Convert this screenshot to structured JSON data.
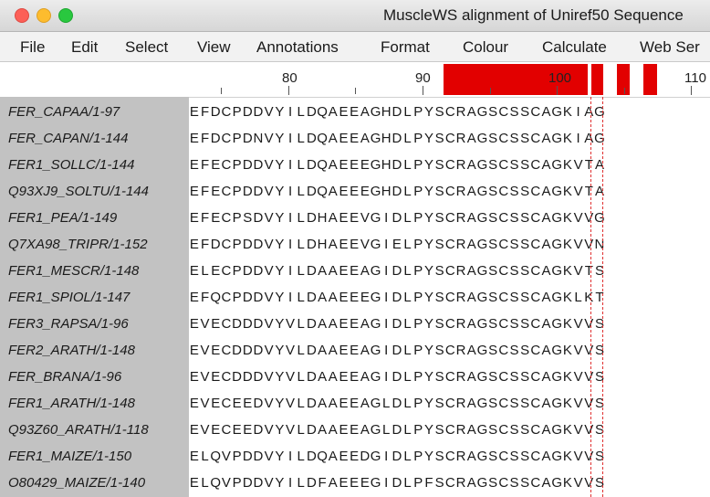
{
  "window": {
    "title": "MuscleWS alignment of Uniref50 Sequence"
  },
  "menu": [
    "File",
    "Edit",
    "Select",
    "View",
    "Annotations",
    "Format",
    "Colour",
    "Calculate",
    "Web Ser"
  ],
  "ruler": {
    "labels": [
      "80",
      "90",
      "100",
      "110"
    ]
  },
  "colors": {
    "conservation_bar": "#e20000",
    "name_panel": "#c2c2c2",
    "selection_marker": "#e03030"
  },
  "rows": [
    {
      "name": "FER_CAPAA/1-97",
      "seq": "EFDCPDDVYILDQAEEAGHDLPYSCRAGSCSSCAGKIAG"
    },
    {
      "name": "FER_CAPAN/1-144",
      "seq": "EFDCPDNVYILDQAEEAGHDLPYSCRAGSCSSCAGKIAG"
    },
    {
      "name": "FER1_SOLLC/1-144",
      "seq": "EFECPDDVYILDQAEEEGHDLPYSCRAGSCSSCAGKVTA"
    },
    {
      "name": "Q93XJ9_SOLTU/1-144",
      "seq": "EFECPDDVYILDQAEEEGHDLPYSCRAGSCSSCAGKVTA"
    },
    {
      "name": "FER1_PEA/1-149",
      "seq": "EFECPSDVYILDHAEEVGIDLPYSCRAGSCSSCAGKVVG"
    },
    {
      "name": "Q7XA98_TRIPR/1-152",
      "seq": "EFDCPDDVYILDHAEEVGIELPYSCRAGSCSSCAGKVVN"
    },
    {
      "name": "FER1_MESCR/1-148",
      "seq": "ELECPDDVYILDAAEEAGIDLPYSCRAGSCSSCAGKVTS"
    },
    {
      "name": "FER1_SPIOL/1-147",
      "seq": "EFQCPDDVYILDAAEEEGIDLPYSCRAGSCSSCAGKLKT"
    },
    {
      "name": "FER3_RAPSA/1-96",
      "seq": "EVECDDDVYVLDAAEEAGIDLPYSCRAGSCSSCAGKVVS"
    },
    {
      "name": "FER2_ARATH/1-148",
      "seq": "EVECDDDVYVLDAAEEAGIDLPYSCRAGSCSSCAGKVVS"
    },
    {
      "name": "FER_BRANA/1-96",
      "seq": "EVECDDDVYVLDAAEEAGIDLPYSCRAGSCSSCAGKVVS"
    },
    {
      "name": "FER1_ARATH/1-148",
      "seq": "EVECEEDVYVLDAAEEAGLDLPYSCRAGSCSSCAGKVVS"
    },
    {
      "name": "Q93Z60_ARATH/1-118",
      "seq": "EVECEEDVYVLDAAEEAGLDLPYSCRAGSCSSCAGKVVS"
    },
    {
      "name": "FER1_MAIZE/1-150",
      "seq": "ELQVPDDVYILDQAEEDGIDLPYSCRAGSCSSCAGKVVS"
    },
    {
      "name": "O80429_MAIZE/1-140",
      "seq": "ELQVPDDVYILDFAEEEGIDLPFSCRAGSCSSCAGKVVS"
    }
  ]
}
